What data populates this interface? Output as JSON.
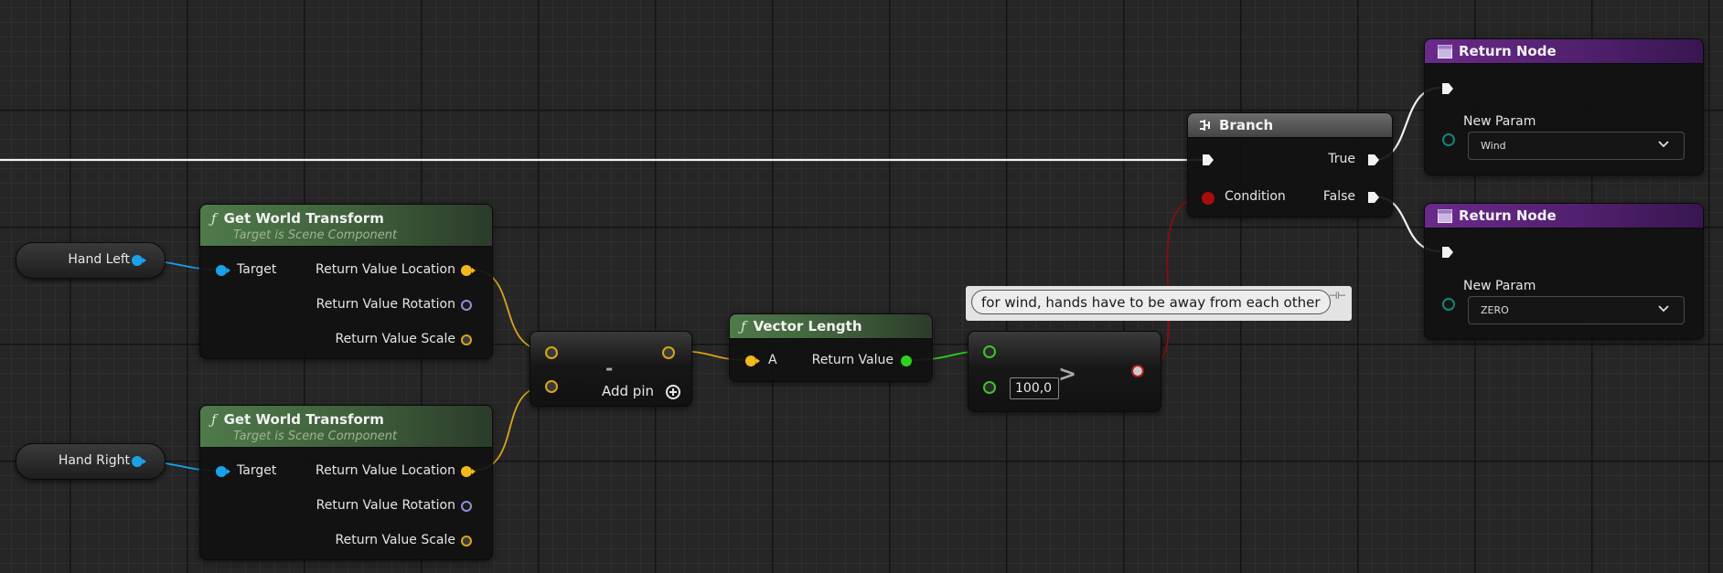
{
  "variables": {
    "hand_left": "Hand Left",
    "hand_right": "Hand Right"
  },
  "get_world_transform_1": {
    "title": "Get World Transform",
    "subtitle": "Target is Scene Component",
    "target_label": "Target",
    "location_label": "Return Value Location",
    "rotation_label": "Return Value Rotation",
    "scale_label": "Return Value Scale",
    "function_icon": "ƒ"
  },
  "get_world_transform_2": {
    "title": "Get World Transform",
    "subtitle": "Target is Scene Component",
    "target_label": "Target",
    "location_label": "Return Value Location",
    "rotation_label": "Return Value Rotation",
    "scale_label": "Return Value Scale",
    "function_icon": "ƒ"
  },
  "subtract_node": {
    "operator": "-",
    "add_pin_label": "Add pin"
  },
  "vector_length": {
    "title": "Vector Length",
    "input_label": "A",
    "output_label": "Return Value",
    "function_icon": "ƒ"
  },
  "comment": {
    "text": "for wind, hands have to be away from each other"
  },
  "greater_node": {
    "operator": ">",
    "value": "100,0"
  },
  "branch": {
    "title": "Branch",
    "true_label": "True",
    "false_label": "False",
    "condition_label": "Condition"
  },
  "return_node_1": {
    "title": "Return Node",
    "param_label": "New Param",
    "param_value": "Wind"
  },
  "return_node_2": {
    "title": "Return Node",
    "param_label": "New Param",
    "param_value": "ZERO"
  },
  "colors": {
    "vector_pin": "#f2b81d",
    "object_pin": "#19a2ea",
    "rotator_pin": "#8d93d6",
    "float_pin": "#2fd21e",
    "bool_pin": "#a80d0d",
    "enum_pin": "#13857c",
    "exec_wire": "#f2f2f2",
    "function_header": "#4f7a4a",
    "return_header": "#6a2a8a"
  },
  "icons": {
    "branch_icon": "branch-icon",
    "return_icon": "return-node-icon",
    "comment_pin": "pin-icon",
    "dropdown": "chevron-down-icon",
    "add_pin": "plus-circle-icon"
  }
}
